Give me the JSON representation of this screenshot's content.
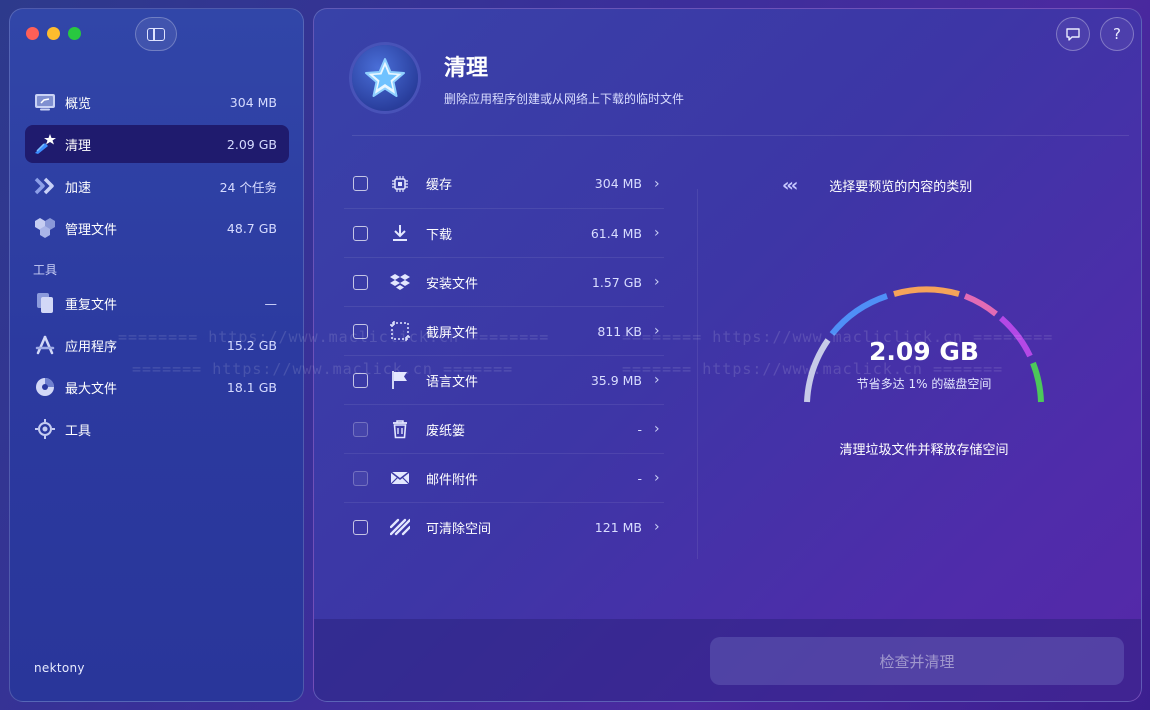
{
  "sidebar": {
    "items": [
      {
        "label": "概览",
        "value": "304 MB",
        "icon": "overview-icon"
      },
      {
        "label": "清理",
        "value": "2.09 GB",
        "icon": "cleanup-icon"
      },
      {
        "label": "加速",
        "value": "24 个任务",
        "icon": "speedup-icon"
      },
      {
        "label": "管理文件",
        "value": "48.7 GB",
        "icon": "manage-files-icon"
      }
    ],
    "tools_label": "工具",
    "tools": [
      {
        "label": "重复文件",
        "value": "—",
        "icon": "duplicate-files-icon"
      },
      {
        "label": "应用程序",
        "value": "15.2 GB",
        "icon": "applications-icon"
      },
      {
        "label": "最大文件",
        "value": "18.1 GB",
        "icon": "largest-files-icon"
      },
      {
        "label": "工具",
        "value": "",
        "icon": "tools-icon"
      }
    ],
    "brand": "nektony"
  },
  "header": {
    "title": "清理",
    "subtitle": "删除应用程序创建或从网络上下载的临时文件"
  },
  "categories": [
    {
      "label": "缓存",
      "value": "304 MB",
      "icon": "cache-chip-icon",
      "enabled": true
    },
    {
      "label": "下载",
      "value": "61.4 MB",
      "icon": "download-icon",
      "enabled": true
    },
    {
      "label": "安装文件",
      "value": "1.57 GB",
      "icon": "installer-dropbox-icon",
      "enabled": true
    },
    {
      "label": "截屏文件",
      "value": "811 KB",
      "icon": "screenshot-icon",
      "enabled": true
    },
    {
      "label": "语言文件",
      "value": "35.9 MB",
      "icon": "language-flag-icon",
      "enabled": true
    },
    {
      "label": "废纸篓",
      "value": "-",
      "icon": "trash-icon",
      "enabled": false
    },
    {
      "label": "邮件附件",
      "value": "-",
      "icon": "mail-icon",
      "enabled": false
    },
    {
      "label": "可清除空间",
      "value": "121 MB",
      "icon": "purgeable-icon",
      "enabled": true
    }
  ],
  "preview": {
    "title": "选择要预览的内容的类别",
    "gauge_value": "2.09 GB",
    "gauge_sub": "节省多达 1% 的磁盘空间",
    "caption": "清理垃圾文件并释放存储空间"
  },
  "action_button": "检查并清理",
  "watermark": {
    "line1": "======== https://www.macliclick.cn ========",
    "line2": "======= https://www.maclick.cn ======="
  },
  "colors": {
    "gauge": [
      "#c7cbe8",
      "#4f8ff7",
      "#f5a35a",
      "#e26bb5",
      "#b448e6",
      "#4cc85a"
    ],
    "active_item": "#1f1b6e"
  }
}
